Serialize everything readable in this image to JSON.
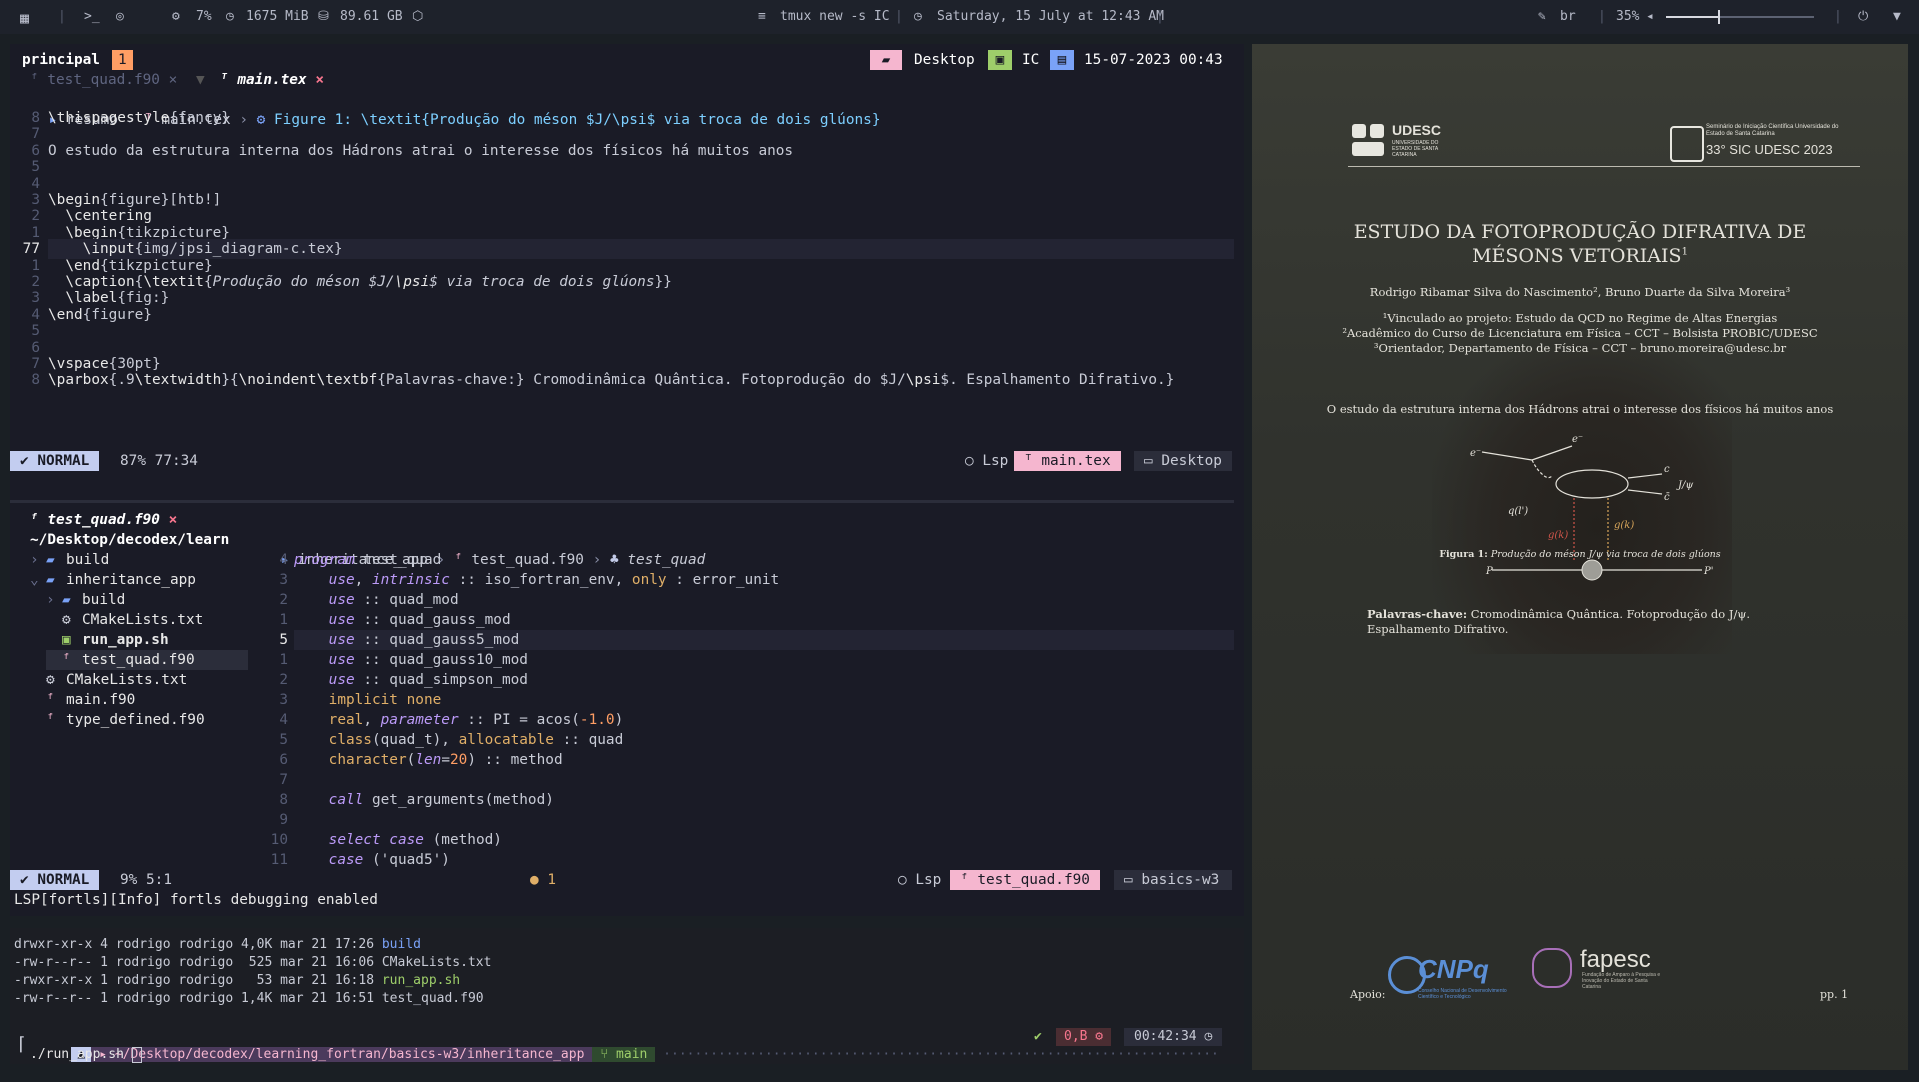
{
  "topbar": {
    "cpu": "7%",
    "ram": "1675 MiB",
    "disk": "89.61 GB",
    "window_title": "tmux new -s IC",
    "datetime": "Saturday, 15 July at 12:43 AM",
    "keyboard_layout": "br",
    "volume": "35%",
    "volume_level": 0.35
  },
  "tmux": {
    "session": "principal",
    "window_index": "1",
    "right_1": "Desktop",
    "right_2": "IC",
    "right_3": "15-07-2023 00:43"
  },
  "top_editor": {
    "tabs": [
      "test_quad.f90",
      "main.tex"
    ],
    "breadcrumb": [
      "resumo",
      "main.tex",
      "Figure 1: \\textit{Produção do méson $J/\\psi$ via troca de dois glúons}"
    ],
    "lines": [
      {
        "n": "8",
        "text": "\\thispagestyle{fancy}"
      },
      {
        "n": "7",
        "text": ""
      },
      {
        "n": "6",
        "text": "O estudo da estrutura interna dos Hádrons atrai o interesse dos físicos há muitos anos"
      },
      {
        "n": "5",
        "text": ""
      },
      {
        "n": "4",
        "text": ""
      },
      {
        "n": "3",
        "text": "\\begin{figure}[htb!]"
      },
      {
        "n": "2",
        "text": "  \\centering"
      },
      {
        "n": "1",
        "text": "  \\begin{tikzpicture}"
      },
      {
        "n": "77",
        "text": "    \\input{img/jpsi_diagram-c.tex}"
      },
      {
        "n": "1",
        "text": "  \\end{tikzpicture}"
      },
      {
        "n": "2",
        "text": "  \\caption{\\textit{Produção do méson $J/\\psi$ via troca de dois glúons}}"
      },
      {
        "n": "3",
        "text": "  \\label{fig:}"
      },
      {
        "n": "4",
        "text": "\\end{figure}"
      },
      {
        "n": "5",
        "text": ""
      },
      {
        "n": "6",
        "text": ""
      },
      {
        "n": "7",
        "text": "\\vspace{30pt}"
      },
      {
        "n": "8",
        "text": "\\parbox{.9\\textwidth}{\\noindent\\textbf{Palavras-chave:} Cromodinâmica Quântica. Fotoprodução do $J/\\psi$. Espalhamento Difrativo.}"
      }
    ],
    "status": {
      "mode": "NORMAL",
      "position": "87% 77:34",
      "lsp": "Lsp",
      "file": "main.tex",
      "dir": "Desktop"
    }
  },
  "bottom_editor": {
    "tab": "test_quad.f90",
    "tree_root": "~/Desktop/decodex/learn",
    "tree": [
      {
        "indent": 0,
        "arrow": "›",
        "icon": "folder",
        "name": "build"
      },
      {
        "indent": 0,
        "arrow": "⌄",
        "icon": "folder",
        "name": "inheritance_app"
      },
      {
        "indent": 1,
        "arrow": "›",
        "icon": "folder",
        "name": "build"
      },
      {
        "indent": 1,
        "arrow": "",
        "icon": "gear",
        "name": "CMakeLists.txt"
      },
      {
        "indent": 1,
        "arrow": "",
        "icon": "shell",
        "name": "run_app.sh"
      },
      {
        "indent": 1,
        "arrow": "",
        "icon": "fortran",
        "name": "test_quad.f90"
      },
      {
        "indent": 0,
        "arrow": "",
        "icon": "gear",
        "name": "CMakeLists.txt"
      },
      {
        "indent": 0,
        "arrow": "",
        "icon": "fortran",
        "name": "main.f90"
      },
      {
        "indent": 0,
        "arrow": "",
        "icon": "fortran",
        "name": "type_defined.f90"
      }
    ],
    "breadcrumb": [
      "inheritance_app",
      "test_quad.f90",
      "test_quad"
    ],
    "lines": [
      {
        "n": "4",
        "text": "program test_quad"
      },
      {
        "n": "3",
        "text": "    use, intrinsic :: iso_fortran_env, only : error_unit"
      },
      {
        "n": "2",
        "text": "    use :: quad_mod"
      },
      {
        "n": "1",
        "text": "    use :: quad_gauss_mod"
      },
      {
        "n": "5",
        "text": "    use :: quad_gauss5_mod"
      },
      {
        "n": "1",
        "text": "    use :: quad_gauss10_mod"
      },
      {
        "n": "2",
        "text": "    use :: quad_simpson_mod"
      },
      {
        "n": "3",
        "text": "    implicit none"
      },
      {
        "n": "4",
        "text": "    real, parameter :: PI = acos(-1.0)"
      },
      {
        "n": "5",
        "text": "    class(quad_t), allocatable :: quad"
      },
      {
        "n": "6",
        "text": "    character(len=20) :: method"
      },
      {
        "n": "7",
        "text": ""
      },
      {
        "n": "8",
        "text": "    call get_arguments(method)"
      },
      {
        "n": "9",
        "text": ""
      },
      {
        "n": "10",
        "text": "    select case (method)"
      },
      {
        "n": "11",
        "text": "    case ('quad5')"
      }
    ],
    "status": {
      "mode": "NORMAL",
      "position": "9% 5:1",
      "diag": "1",
      "lsp": "Lsp",
      "file": "test_quad.f90",
      "dir": "basics-w3"
    },
    "message": "LSP[fortls][Info] fortls debugging enabled"
  },
  "shell": {
    "listing": [
      {
        "perm": "drwxr-xr-x 4 rodrigo rodrigo 4,0K mar 21 17:26",
        "name": "build",
        "color": "#7aa2f7"
      },
      {
        "perm": "-rw-r--r-- 1 rodrigo rodrigo  525 mar 21 16:06",
        "name": "CMakeLists.txt",
        "color": "#c8cbd6"
      },
      {
        "perm": "-rwxr-xr-x 1 rodrigo rodrigo   53 mar 21 16:18",
        "name": "run_app.sh",
        "color": "#9ece6a"
      },
      {
        "perm": "-rw-r--r-- 1 rodrigo rodrigo 1,4K mar 21 16:51",
        "name": "test_quad.f90",
        "color": "#c8cbd6"
      }
    ],
    "prompt_path": "~/Desktop/decodex/learning_fortran/basics-w3/inheritance_app",
    "branch": "main",
    "status_ok": "✔",
    "exit_info": "0,B",
    "clock": "00:42:34",
    "command": "./run_app.sh"
  },
  "pdf": {
    "logo_left": "UDESC",
    "logo_left_sub": "UNIVERSIDADE DO ESTADO DE SANTA CATARINA",
    "logo_right_small": "Seminário de Iniciação Científica Universidade do Estado de Santa Catarina",
    "logo_right": "33° SIC UDESC 2023",
    "title_1": "ESTUDO DA FOTOPRODUÇÃO DIFRATIVA DE",
    "title_2": "MÉSONS VETORIAIS",
    "authors": "Rodrigo Ribamar Silva do Nascimento², Bruno Duarte da Silva Moreira³",
    "aff_1": "¹Vinculado ao projeto: Estudo da QCD no Regime de Altas Energias",
    "aff_2": "²Acadêmico do Curso de Licenciatura em Física – CCT – Bolsista PROBIC/UDESC",
    "aff_3": "³Orientador, Departamento de Física – CCT – bruno.moreira@udesc.br",
    "body": "O estudo da estrutura interna dos Hádrons atrai o interesse dos físicos há muitos anos",
    "figure_caption_label": "Figura 1:",
    "figure_caption": "Produção do méson J/ψ via troca de dois glúons",
    "keywords_label": "Palavras-chave:",
    "keywords": "Cromodinâmica Quântica. Fotoprodução do J/ψ. Espalhamento Difrativo.",
    "support_label": "Apoio:",
    "logo_cnpq": "CNPq",
    "logo_cnpq_sub": "Conselho Nacional de Desenvolvimento Científico e Tecnológico",
    "logo_fapesc": "fapesc",
    "logo_fapesc_sub": "Fundação de Amparo à Pesquisa e Inovação do Estado de Santa Catarina",
    "page": "pp. 1",
    "diagram": {
      "e_in": "e⁻",
      "e_out": "e⁻",
      "c1": "c",
      "c2": "c̄",
      "jpsi": "J/ψ",
      "q_l": "q(l')",
      "g_k": "g(k)",
      "g_k2": "g(k)",
      "p_in": "P",
      "p_out": "P'"
    }
  },
  "colors": {
    "accent": "#c3cdf0",
    "pink": "#f7768e",
    "pink_light": "#f5b6cf",
    "green": "#9ece6a"
  }
}
